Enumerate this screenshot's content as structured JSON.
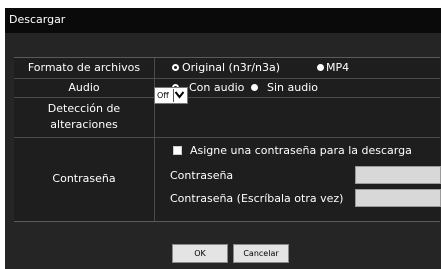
{
  "window": {
    "title": "Descargar"
  },
  "format": {
    "label": "Formato de archivos",
    "options": [
      {
        "label": "Original (n3r/n3a)",
        "selected": true
      },
      {
        "label": "MP4",
        "selected": false
      }
    ]
  },
  "audio": {
    "label": "Audio",
    "options": [
      {
        "label": "Con audio",
        "selected": true
      },
      {
        "label": "Sin audio",
        "selected": false
      }
    ]
  },
  "tamper": {
    "label_line1": "Detección de",
    "label_line2": "alteraciones",
    "value": "Off"
  },
  "password": {
    "label": "Contraseña",
    "checkbox_label": "Asigne una contraseña para la descarga",
    "checked": false,
    "field1_label": "Contraseña",
    "field1_value": "",
    "field2_label": "Contraseña (Escríbala otra vez)",
    "field2_value": ""
  },
  "buttons": {
    "ok": "OK",
    "cancel": "Cancelar"
  }
}
